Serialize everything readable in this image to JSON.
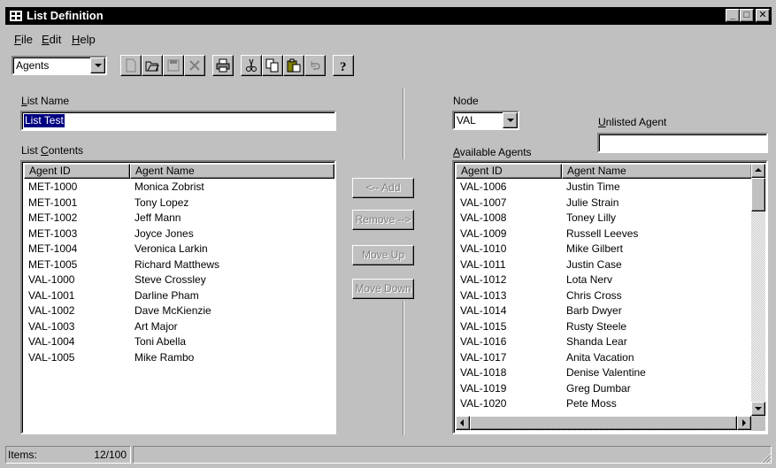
{
  "window": {
    "title": "List Definition"
  },
  "menu": {
    "file_u": "F",
    "file_rest": "ile",
    "edit_u": "E",
    "edit_rest": "dit",
    "help_u": "H",
    "help_rest": "elp"
  },
  "toolbar": {
    "type_combo_value": "Agents",
    "icons": [
      "new-icon",
      "open-icon",
      "save-icon",
      "delete-icon",
      "print-icon",
      "cut-icon",
      "copy-icon",
      "paste-icon",
      "undo-icon",
      "help-icon"
    ]
  },
  "left": {
    "list_name_u": "L",
    "list_name_rest": "ist Name",
    "list_name_value": "List Test",
    "list_contents_pre": "List ",
    "list_contents_u": "C",
    "list_contents_rest": "ontents",
    "columns": [
      "Agent ID",
      "Agent Name"
    ],
    "rows": [
      [
        "MET-1000",
        "Monica Zobrist"
      ],
      [
        "MET-1001",
        "Tony Lopez"
      ],
      [
        "MET-1002",
        "Jeff Mann"
      ],
      [
        "MET-1003",
        "Joyce Jones"
      ],
      [
        "MET-1004",
        "Veronica Larkin"
      ],
      [
        "MET-1005",
        "Richard Matthews"
      ],
      [
        "VAL-1000",
        "Steve Crossley"
      ],
      [
        "VAL-1001",
        "Darline Pham"
      ],
      [
        "VAL-1002",
        "Dave McKienzie"
      ],
      [
        "VAL-1003",
        "Art Major"
      ],
      [
        "VAL-1004",
        "Toni Abella"
      ],
      [
        "VAL-1005",
        "Mike Rambo"
      ]
    ]
  },
  "buttons": {
    "add": "<-- Add",
    "remove": "Remove -->",
    "move_up": "Move Up",
    "move_down": "Move Down"
  },
  "right": {
    "node_label": "Node",
    "node_value": "VAL",
    "unlisted_u": "U",
    "unlisted_rest": "nlisted Agent",
    "unlisted_value": "",
    "available_u": "A",
    "available_rest": "vailable Agents",
    "columns": [
      "Agent ID",
      "Agent Name"
    ],
    "rows": [
      [
        "VAL-1006",
        "Justin Time"
      ],
      [
        "VAL-1007",
        "Julie Strain"
      ],
      [
        "VAL-1008",
        "Toney Lilly"
      ],
      [
        "VAL-1009",
        "Russell Leeves"
      ],
      [
        "VAL-1010",
        "Mike Gilbert"
      ],
      [
        "VAL-1011",
        "Justin Case"
      ],
      [
        "VAL-1012",
        "Lota Nerv"
      ],
      [
        "VAL-1013",
        "Chris Cross"
      ],
      [
        "VAL-1014",
        "Barb Dwyer"
      ],
      [
        "VAL-1015",
        "Rusty Steele"
      ],
      [
        "VAL-1016",
        "Shanda Lear"
      ],
      [
        "VAL-1017",
        "Anita Vacation"
      ],
      [
        "VAL-1018",
        "Denise Valentine"
      ],
      [
        "VAL-1019",
        "Greg Dumbar"
      ],
      [
        "VAL-1020",
        "Pete Moss"
      ]
    ]
  },
  "status": {
    "items_label": "Items:",
    "items_value": "12/100"
  }
}
